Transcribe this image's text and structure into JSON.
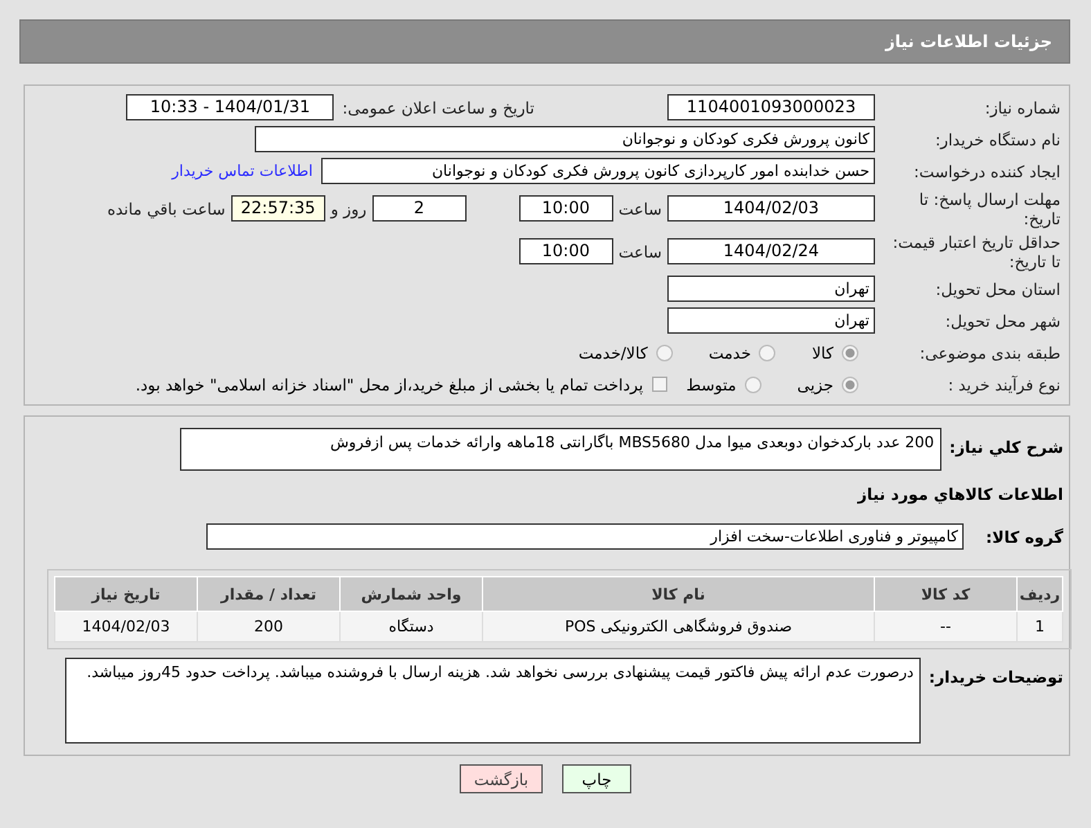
{
  "header": {
    "title": "جزئیات اطلاعات نیاز"
  },
  "need_number": {
    "label": "شماره نیاز:",
    "value": "1104001093000023"
  },
  "announce": {
    "label": "تاریخ و ساعت اعلان عمومی:",
    "value": "1404/01/31 - 10:33"
  },
  "buyer_org": {
    "label": "نام دستگاه خریدار:",
    "value": "کانون پرورش فکری کودکان و نوجوانان"
  },
  "requester": {
    "label": "ایجاد کننده درخواست:",
    "value": "حسن خدابنده امور کارپردازی  کانون پرورش فکری کودکان و نوجوانان",
    "link": "اطلاعات تماس خریدار"
  },
  "reply_deadline": {
    "label": "مهلت ارسال پاسخ: تا تاریخ:",
    "date": "1404/02/03",
    "time_label": "ساعت",
    "time": "10:00",
    "days": "2",
    "days_label": "روز و",
    "remaining": "22:57:35",
    "remaining_label": "ساعت باقي مانده"
  },
  "price_validity": {
    "label": "حداقل تاریخ اعتبار قیمت: تا تاریخ:",
    "date": "1404/02/24",
    "time_label": "ساعت",
    "time": "10:00"
  },
  "province": {
    "label": "استان محل تحویل:",
    "value": "تهران"
  },
  "city": {
    "label": "شهر محل تحویل:",
    "value": "تهران"
  },
  "category": {
    "label": "طبقه بندی موضوعی:",
    "options": [
      {
        "label": "کالا",
        "selected": true
      },
      {
        "label": "خدمت",
        "selected": false
      },
      {
        "label": "کالا/خدمت",
        "selected": false
      }
    ]
  },
  "purchase_type": {
    "label": "نوع فرآیند خرید :",
    "options": [
      {
        "label": "جزیی",
        "selected": true
      },
      {
        "label": "متوسط",
        "selected": false
      }
    ],
    "treasury": {
      "label": "پرداخت تمام یا بخشی از مبلغ خرید،از محل \"اسناد خزانه اسلامی\" خواهد بود.",
      "checked": false
    }
  },
  "description": {
    "label": "شرح كلي نياز:",
    "value": "200 عدد بارکدخوان دوبعدی میوا مدل MBS5680  باگارانتی 18ماهه وارائه خدمات پس ازفروش"
  },
  "goods": {
    "title": "اطلاعات کالاهاي مورد نياز",
    "group": {
      "label": "گروه کالا:",
      "value": "کامپیوتر و فناوری اطلاعات-سخت افزار"
    },
    "table": {
      "columns": [
        "ردیف",
        "کد کالا",
        "نام کالا",
        "واحد شمارش",
        "تعداد / مقدار",
        "تاریخ نیاز"
      ],
      "rows": [
        [
          "1",
          "--",
          "صندوق فروشگاهی الکترونیکی POS",
          "دستگاه",
          "200",
          "1404/02/03"
        ]
      ]
    }
  },
  "buyer_notes": {
    "label": "توضیحات خریدار:",
    "value": "درصورت عدم ارائه پیش فاکتور قیمت پیشنهادی بررسی نخواهد شد. هزینه ارسال با فروشنده میباشد. پرداخت حدود 45روز میباشد."
  },
  "buttons": [
    {
      "label": "چاپ",
      "kind": "print"
    },
    {
      "label": "بازگشت",
      "kind": "back"
    }
  ]
}
